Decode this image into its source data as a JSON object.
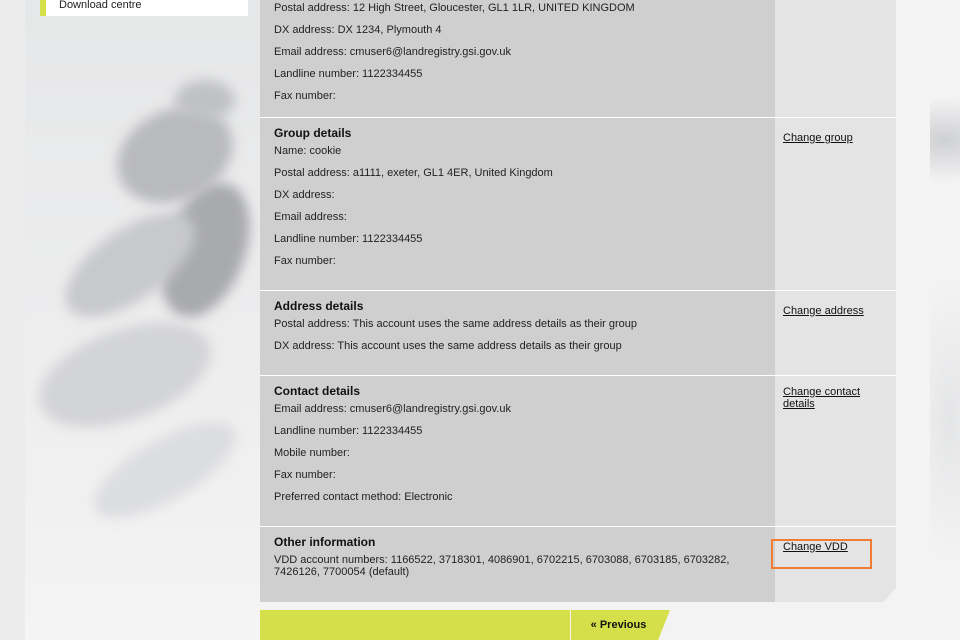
{
  "sidebar": {
    "items": [
      {
        "label": "Download centre"
      }
    ]
  },
  "sections": {
    "account": {
      "postal": "Postal address: 12 High Street, Gloucester, GL1 1LR, UNITED KINGDOM",
      "dx": "DX address: DX 1234, Plymouth 4",
      "email": "Email address: cmuser6@landregistry.gsi.gov.uk",
      "landline": "Landline number: 1122334455",
      "fax": "Fax number:"
    },
    "group": {
      "title": "Group details",
      "name": "Name: cookie",
      "postal": "Postal address: a1111, exeter, GL1 4ER, United Kingdom",
      "dx": "DX address:",
      "email": "Email address:",
      "landline": "Landline number: 1122334455",
      "fax": "Fax number:",
      "action": "Change group"
    },
    "address": {
      "title": "Address details",
      "postal": "Postal address: This account uses the same address details as their group",
      "dx": "DX address: This account uses the same address details as their group",
      "action": "Change address"
    },
    "contact": {
      "title": "Contact details",
      "email": "Email address: cmuser6@landregistry.gsi.gov.uk",
      "landline": "Landline number: 1122334455",
      "mobile": "Mobile number:",
      "fax": "Fax number:",
      "preferred": "Preferred contact method: Electronic",
      "action": "Change contact details"
    },
    "other": {
      "title": "Other information",
      "vdd": "VDD account numbers: 1166522, 3718301, 4086901, 6702215, 6703088, 6703185, 6703282, 7426126, 7700054 (default)",
      "action": "Change VDD"
    }
  },
  "footer": {
    "previous_label": "« Previous"
  },
  "colors": {
    "accent": "#d4df4a",
    "highlight": "#f07d33",
    "panel": "#cfcfd0",
    "action_panel": "#e4e4e5"
  }
}
